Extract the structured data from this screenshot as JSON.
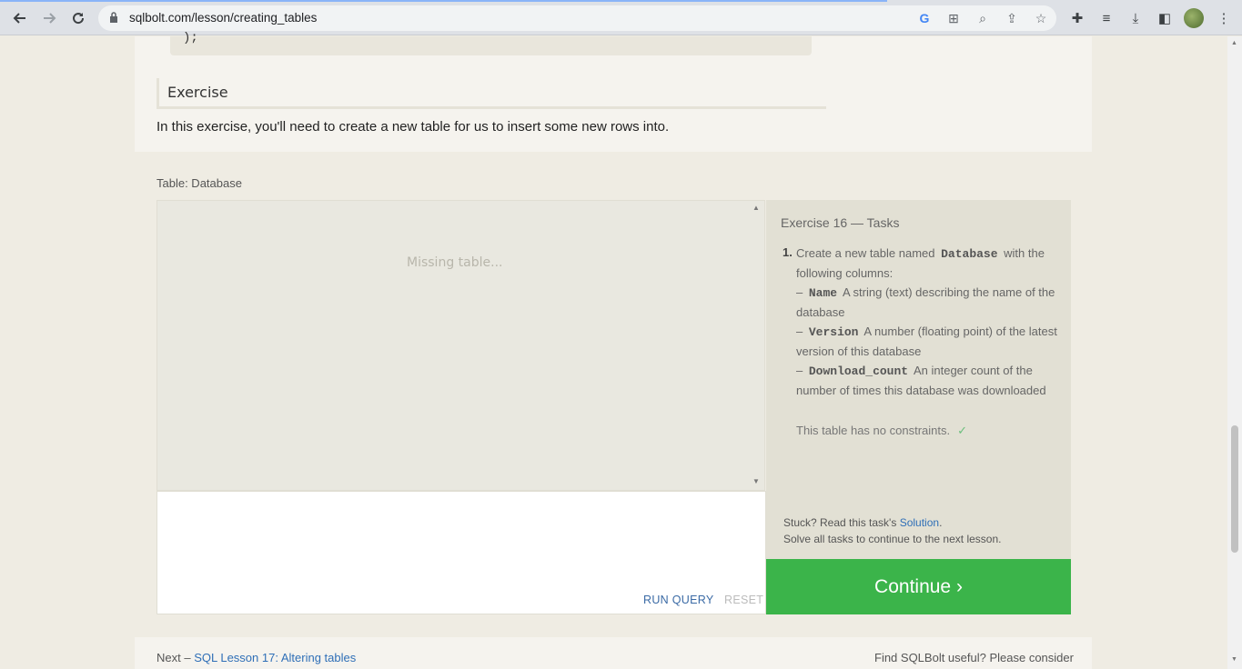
{
  "browser": {
    "url": "sqlbolt.com/lesson/creating_tables",
    "back_icon": "arrow-left",
    "forward_icon": "arrow-right",
    "reload_icon": "reload"
  },
  "lesson": {
    "code_tail": ");",
    "exercise_heading": "Exercise",
    "intro": "In this exercise, you'll need to create a new table for us to insert some new rows into."
  },
  "exercise": {
    "table_label": "Table: Database",
    "missing_table": "Missing table...",
    "run_query": "RUN QUERY",
    "reset": "RESET",
    "tasks_title": "Exercise 16 — Tasks",
    "task_number": "1.",
    "task": {
      "intro_a": "Create a new table named",
      "table_name": "Database",
      "intro_b": "with the following columns:",
      "cols": [
        {
          "dash": "–",
          "name": "Name",
          "desc": "A string (text) describing the name of the database"
        },
        {
          "dash": "–",
          "name": "Version",
          "desc": "A number (floating point) of the latest version of this database"
        },
        {
          "dash": "–",
          "name": "Download_count",
          "desc": "An integer count of the number of times this database was downloaded"
        }
      ]
    },
    "constraint": "This table has no constraints.",
    "check": "✓",
    "stuck_prefix": "Stuck? Read this task's",
    "solution_link": "Solution",
    "stuck_suffix": ".",
    "solve_all": "Solve all tasks to continue to the next lesson.",
    "continue": "Continue ›"
  },
  "footer": {
    "next_prefix": "Next –",
    "next_link": "SQL Lesson 17: Altering tables",
    "useful": "Find SQLBolt useful? Please consider"
  },
  "colors": {
    "continue_bg": "#3bb44a",
    "link": "#2f6fb7"
  }
}
